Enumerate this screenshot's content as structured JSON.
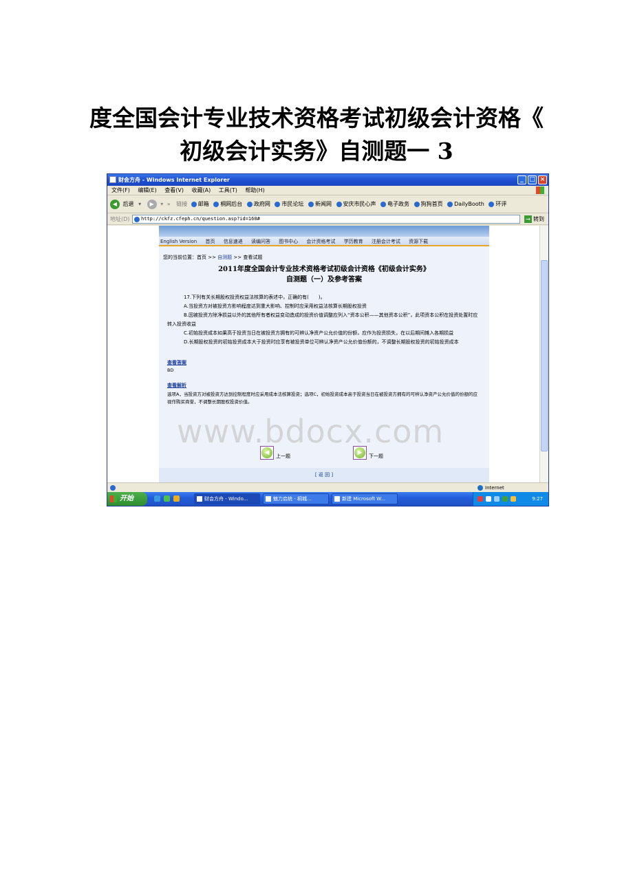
{
  "document_title": {
    "line1": "度全国会计专业技术资格考试初级会计资格《",
    "line2": "初级会计实务》自测题一 3"
  },
  "window": {
    "title": "财会方舟 - Windows Internet Explorer",
    "min": "_",
    "max": "□",
    "close": "×"
  },
  "menu": [
    "文件(F)",
    "编辑(E)",
    "查看(V)",
    "收藏(A)",
    "工具(T)",
    "帮助(H)"
  ],
  "toolbar": {
    "back": "后退",
    "links_label": "链接",
    "links": [
      "邮箱",
      "桐网后台",
      "政府网",
      "市民论坛",
      "新闻网",
      "安庆市民心声",
      "电子政务",
      "狗狗首页",
      "DailyBooth",
      "环评"
    ]
  },
  "address": {
    "label": "地址(D)",
    "url": "http://ckfz.cfeph.cn/question.asp?id=160#",
    "go": "转到"
  },
  "site": {
    "nav": [
      "English Version",
      "首页",
      "信息速递",
      "读编问答",
      "图书中心",
      "会计资格考试",
      "学历教育",
      "注册会计考试",
      "资源下载"
    ],
    "breadcrumb": {
      "prefix": "您的当前位置：首页 >> ",
      "current": "自测题",
      "suffix": " >> 查看试题"
    },
    "title_line1": "2011年度全国会计专业技术资格考试初级会计资格《初级会计实务》",
    "title_line2": "自测题（一）及参考答案",
    "question": [
      "17.下列有关长期股权投资权益法核算的表述中，正确的有(　　)。",
      "A.当投资方对被投资方影响程度达到重大影响、控制时应采用权益法核算长期股权投资",
      "B.因被投资方除净损益以外的其他所有者权益变动造成的投资价值调整应列入“资本公积——其他资本公积”，此项资本公积在投资处置时应转入投资收益",
      "C.初始投资成本如果高于投资当日在被投资方拥有的可辨认净资产公允价值的份额，应作为投资损失，在以后期间摊入各期损益",
      "D.长期股权投资的初始投资成本大于投资时应享有被投资单位可辨认净资产公允价值份额的，不调整长期股权投资的初始投资成本"
    ],
    "answer_label": "查看答案",
    "answer_value": "BD",
    "explain_label": "查看解析",
    "explain_text": "选项A，当投资方对被投资方达到控制程度时应采用成本法核算投资；选项C，初始投资成本高于投资当日在被投资方拥有的可辨认净资产公允价值的份额的应视作购买商誉，不调整长期股权投资价值。",
    "watermark": "www.bdocx.com",
    "prev": "上一题",
    "next": "下一题",
    "back": "[ 返 回 ]"
  },
  "status": {
    "zone": "Internet"
  },
  "taskbar": {
    "start": "开始",
    "tasks": [
      "财会方舟 - Windo...",
      "魅力启统 - 桐城...",
      "新建 Microsoft W..."
    ],
    "clock": "9:27"
  }
}
